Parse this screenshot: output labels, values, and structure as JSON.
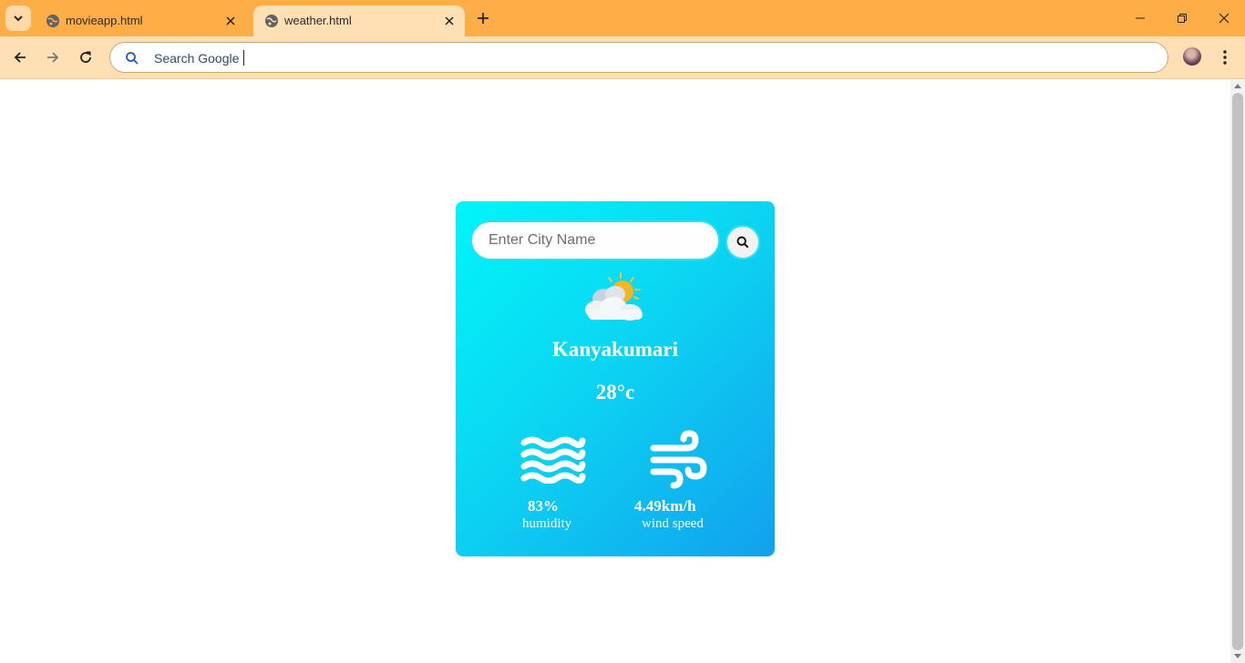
{
  "browser": {
    "tabs": [
      {
        "title": "movieapp.html",
        "active": false
      },
      {
        "title": "weather.html",
        "active": true
      }
    ],
    "omnibox": {
      "placeholder": "Search Google",
      "value": ""
    },
    "icons": {
      "tab_list": "chevron-down-icon",
      "favicon": "globe-icon",
      "tab_close": "close-icon",
      "new_tab": "plus-icon",
      "back": "arrow-left-icon",
      "forward": "arrow-right-icon",
      "reload": "reload-icon",
      "search": "search-icon",
      "profile": "avatar",
      "menu": "kebab-menu-icon",
      "minimize": "minimize-icon",
      "restore": "restore-icon",
      "close_window": "close-icon"
    },
    "colors": {
      "tabstrip": "#ffad46",
      "toolbar": "#ffdfb4"
    }
  },
  "weather": {
    "search": {
      "placeholder": "Enter City Name",
      "value": ""
    },
    "condition_icon": "partly-cloudy-icon",
    "city": "Kanyakumari",
    "temperature": "28°c",
    "humidity": {
      "value": "83%",
      "label": "humidity",
      "icon": "humidity-waves-icon"
    },
    "wind": {
      "value": "4.49km/h",
      "label": "wind speed",
      "icon": "wind-icon"
    },
    "colors": {
      "gradient_start": "#00f5fa",
      "gradient_end": "#12a0ee",
      "text": "#ffffff"
    }
  }
}
